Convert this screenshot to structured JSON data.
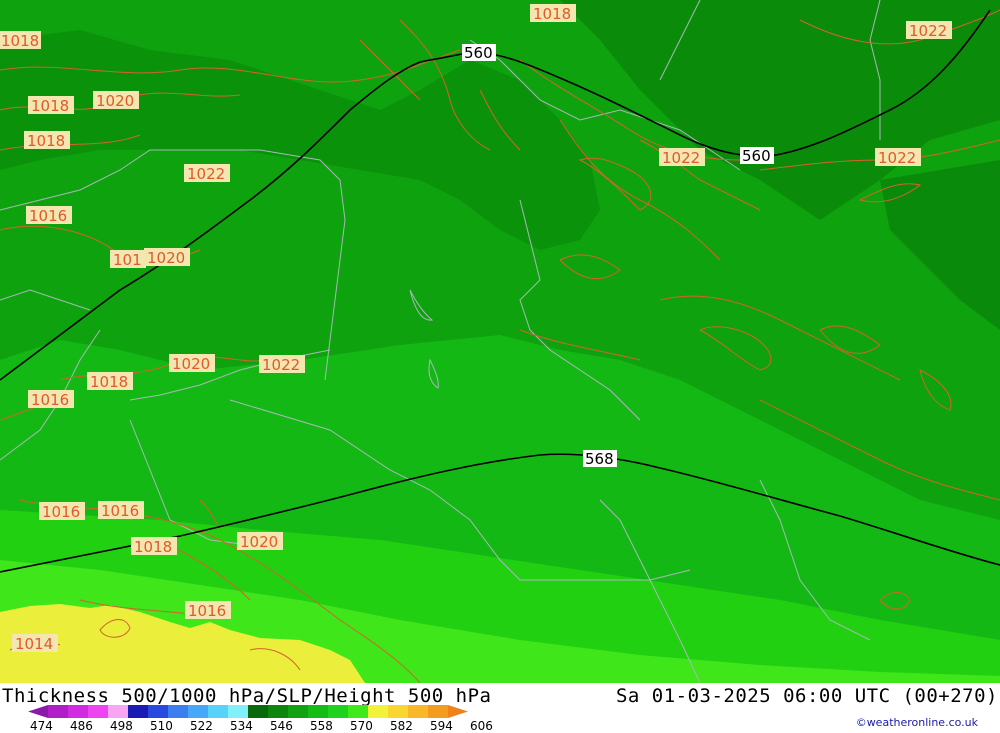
{
  "title": {
    "left": "Thickness 500/1000 hPa/SLP/Height 500 hPa",
    "right": "Sa 01-03-2025 06:00 UTC (00+270)"
  },
  "credit": "©weatheronline.co.uk",
  "scale": {
    "labels": [
      "474",
      "486",
      "498",
      "510",
      "522",
      "534",
      "546",
      "558",
      "570",
      "582",
      "594",
      "606"
    ],
    "colors": [
      "#8b1aa8",
      "#b01ec8",
      "#d22ae0",
      "#ee44f2",
      "#f8a6f4",
      "#1a1ab4",
      "#2848e0",
      "#3a7ef0",
      "#46a8f8",
      "#58d2f8",
      "#82f0fa",
      "#0a6a0a",
      "#0c860c",
      "#10a210",
      "#16bc16",
      "#1ed21e",
      "#40ea1a",
      "#f2f23a",
      "#fad632",
      "#f8b82a",
      "#f29c20",
      "#ee8418"
    ]
  },
  "colors": {
    "zone_dark": "#0a8c0a",
    "zone_mid": "#0ea20e",
    "zone_light": "#14b814",
    "zone_lighter": "#22d012",
    "zone_lime": "#3ee61a",
    "zone_yellow": "#ecee3c",
    "isobar": "#d2642a",
    "height_line": "#000000",
    "border": "#a8b8b8"
  },
  "height_labels": [
    "560",
    "560",
    "568"
  ],
  "slp_labels": [
    "1018",
    "1018",
    "1022",
    "1018",
    "1020",
    "1018",
    "1022",
    "1022",
    "1022",
    "1016",
    "101",
    "1020",
    "1020",
    "1022",
    "1018",
    "1016",
    "1016",
    "1016",
    "1018",
    "1020",
    "1016",
    "1014"
  ]
}
